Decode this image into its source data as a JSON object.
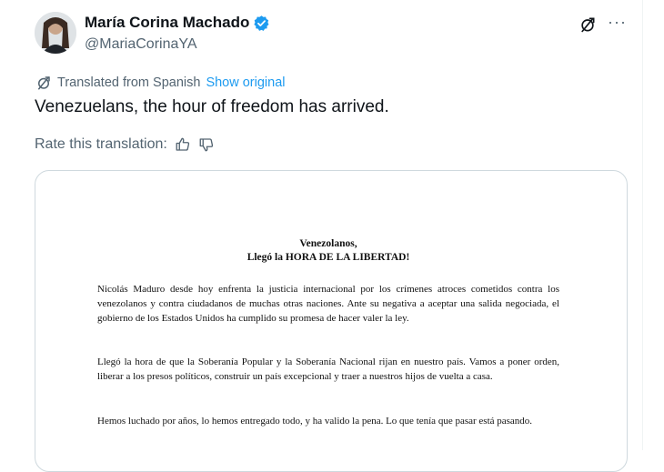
{
  "author": {
    "display_name": "María Corina Machado",
    "handle": "@MariaCorinaYA",
    "verified": true
  },
  "icons": {
    "avatar": "avatar-photo",
    "verified": "verified-badge-icon",
    "translate": "translate-icon",
    "more": "more-icon",
    "like": "thumbs-up-icon",
    "dislike": "thumbs-down-icon"
  },
  "header": {
    "more_label": "···"
  },
  "translation": {
    "label": "Translated from Spanish",
    "show_original": "Show original",
    "rate_label": "Rate this translation:"
  },
  "tweet": {
    "text": "Venezuelans, the hour of freedom has arrived."
  },
  "document": {
    "title": "Venezolanos,",
    "subtitle": "Llegó la HORA DE LA LIBERTAD!",
    "paragraph_1": "Nicolás Maduro desde hoy enfrenta la justicia internacional por los crímenes atroces cometidos contra los venezolanos y contra ciudadanos de muchas otras naciones. Ante su negativa a aceptar una salida negociada, el gobierno de los Estados Unidos ha cumplido su promesa de hacer valer la ley.",
    "paragraph_2": "Llegó la hora de que la Soberanía Popular y la Soberanía Nacional rijan en nuestro país. Vamos a poner orden, liberar a los presos políticos, construir un país excepcional y traer a nuestros hijos de vuelta a casa.",
    "paragraph_3": "Hemos luchado por años, lo hemos entregado todo, y ha valido la pena. Lo que tenía que pasar está pasando."
  },
  "colors": {
    "accent": "#1d9bf0",
    "secondary_text": "#536471",
    "border": "#cfd9de"
  }
}
